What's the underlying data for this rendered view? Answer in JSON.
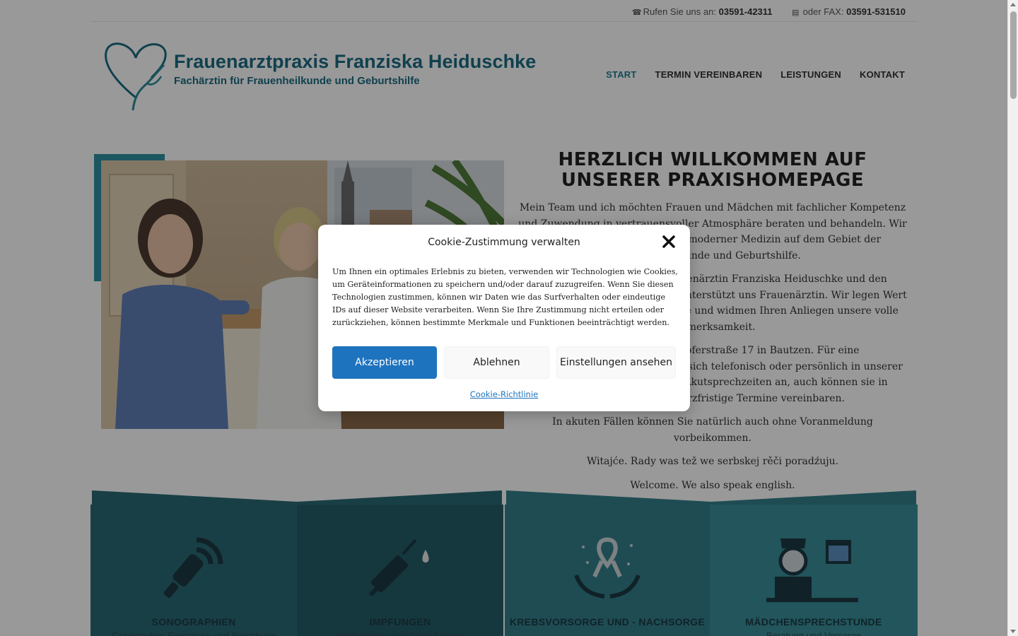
{
  "topbar": {
    "phone_label": "Rufen Sie uns an:",
    "phone_number": "03591-42311",
    "fax_label": "oder FAX:",
    "fax_number": "03591-531510"
  },
  "header": {
    "logo_title": "Frauenarztpraxis Franziska Heiduschke",
    "logo_subtitle": "Fachärztin für Frauenheilkunde und Geburtshilfe"
  },
  "nav": {
    "items": [
      {
        "label": "START"
      },
      {
        "label": "TERMIN VEREINBAREN"
      },
      {
        "label": "LEISTUNGEN"
      },
      {
        "label": "KONTAKT"
      }
    ]
  },
  "welcome": {
    "heading": "HERZLICH WILLKOMMEN AUF UNSERER PRAXISHOMEPAGE",
    "paragraphs": [
      "Mein Team und ich möchten Frauen und Mädchen mit fachlicher Kompetenz und Zuwendung in vertrauensvoller Atmosphäre beraten und behandeln. Wir bieten ein breites Spektrum moderner Medizin auf dem Gebiet der Frauenheilkunde und Geburtshilfe.",
      "Unser Team besteht aus Frauenärztin Franziska Heiduschke und den Arzthelferinnen Geisler. Zudem unterstützt uns Frauenärztin. Wir legen Wert auf eine freundliche Atmosphäre und widmen Ihren Anliegen unsere volle Aufmerksamkeit.",
      "Sie finden uns in der Töpferstraße 17 in Bautzen. Für eine Terminvereinbarung melden Sie sich telefonisch oder persönlich in unserer Praxis. Zusätzlich bieten wir Akutsprechzeiten an, auch können sie in dringenden Fällen kurzfristige Termine vereinbaren.",
      "In akuten Fällen können Sie natürlich auch ohne Voranmeldung vorbeikommen.",
      "Witajće. Rady was tež we serbskej rěči poradźuju.",
      "Welcome. We also speak english."
    ]
  },
  "services": [
    {
      "title": "SONOGRAPHIEN",
      "subtitle": "Gebärmutter, Eierstöcke und Brustdrüse"
    },
    {
      "title": "IMPFUNGEN",
      "subtitle": "Impfberatung und Durchführung"
    },
    {
      "title": "KREBSVORSORGE UND - NACHSORGE",
      "subtitle": ""
    },
    {
      "title": "MÄDCHENSPRECHSTUNDE",
      "subtitle": "Beratung und Vorsorge"
    }
  ],
  "cookie_modal": {
    "title": "Cookie-Zustimmung verwalten",
    "text": "Um Ihnen ein optimales Erlebnis zu bieten, verwenden wir Technologien wie Cookies, um Geräteinformationen zu speichern und/oder darauf zuzugreifen. Wenn Sie diesen Technologien zustimmen, können wir Daten wie das Surfverhalten oder eindeutige IDs auf dieser Website verarbeiten. Wenn Sie Ihre Zustimmung nicht erteilen oder zurückziehen, können bestimmte Merkmale und Funktionen beeinträchtigt werden.",
    "accept_label": "Akzeptieren",
    "deny_label": "Ablehnen",
    "settings_label": "Einstellungen ansehen",
    "policy_link": "Cookie-Richtlinie"
  },
  "colors": {
    "accent": "#1f7f91",
    "logo": "#1b6b82",
    "accept_button": "#1e73be",
    "service_panels": [
      "#2a6a75",
      "#245e68",
      "#347f8b",
      "#3a8e9a"
    ]
  },
  "icons": {
    "phone": "phone-icon",
    "fax": "fax-icon",
    "close": "close-icon",
    "ultrasound": "ultrasound-probe-icon",
    "syringe": "syringe-icon",
    "ribbon": "cancer-ribbon-hands-icon",
    "nurse": "nurse-calendar-icon"
  }
}
